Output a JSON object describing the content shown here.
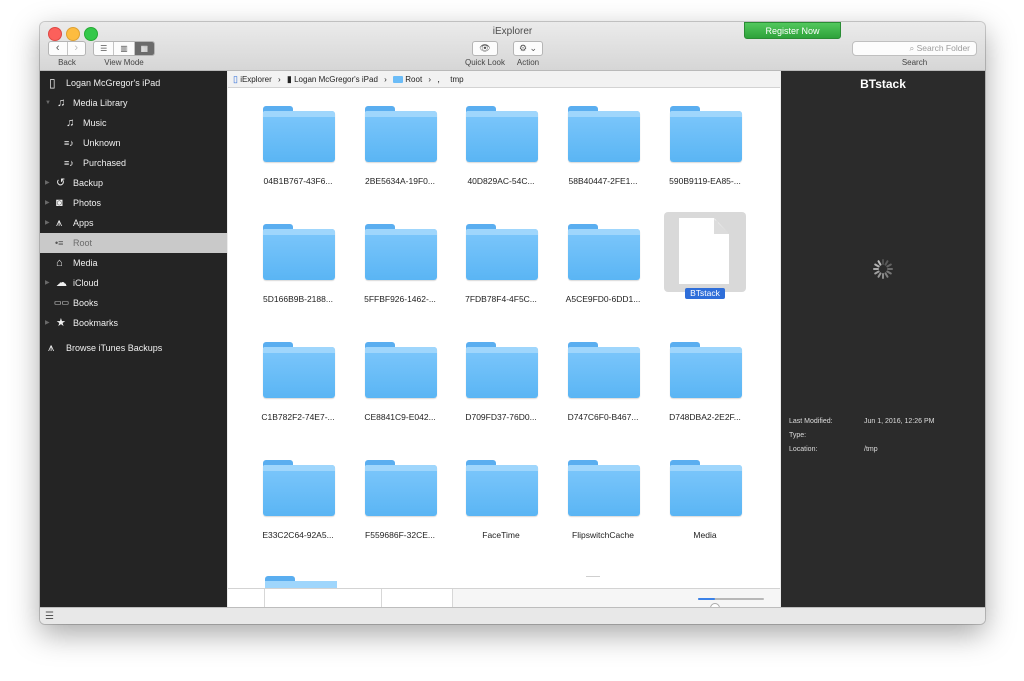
{
  "window": {
    "title": "iExplorer",
    "register_label": "Register Now"
  },
  "toolbar": {
    "back_label": "Back",
    "view_mode_label": "View Mode",
    "quick_look_label": "Quick Look",
    "action_label": "Action",
    "search_placeholder": "Search Folder",
    "search_label": "Search",
    "back_glyph": "‹",
    "forward_glyph": "›",
    "view_glyphs": [
      "☰",
      "▥",
      "▦"
    ],
    "quick_look_glyph": "👁",
    "action_glyph": "⚙ ⌄",
    "search_glyph": "⌕"
  },
  "sidebar": {
    "items": [
      {
        "label": "Logan McGregor's iPad",
        "icon": "ipad-icon",
        "glyph": "▯"
      },
      {
        "label": "Media Library",
        "icon": "music-note-icon",
        "glyph": "♫"
      },
      {
        "label": "Music",
        "icon": "music-note-icon",
        "glyph": "♫"
      },
      {
        "label": "Unknown",
        "icon": "playlist-icon",
        "glyph": "≡♪"
      },
      {
        "label": "Purchased",
        "icon": "playlist-icon",
        "glyph": "≡♪"
      },
      {
        "label": "Backup",
        "icon": "backup-icon",
        "glyph": "↺"
      },
      {
        "label": "Photos",
        "icon": "camera-icon",
        "glyph": "◙"
      },
      {
        "label": "Apps",
        "icon": "apps-icon",
        "glyph": "⩚"
      },
      {
        "label": "Root",
        "icon": "root-icon",
        "glyph": "•≡"
      },
      {
        "label": "Media",
        "icon": "home-media-icon",
        "glyph": "⌂"
      },
      {
        "label": "iCloud",
        "icon": "cloud-icon",
        "glyph": "☁"
      },
      {
        "label": "Books",
        "icon": "book-icon",
        "glyph": "▭▭"
      },
      {
        "label": "Bookmarks",
        "icon": "star-icon",
        "glyph": "★"
      },
      {
        "label": "Browse iTunes Backups",
        "icon": "apps-icon",
        "glyph": "⩚"
      }
    ],
    "selected": "Root"
  },
  "pathbar": {
    "crumbs": [
      "iExplorer",
      "Logan McGregor's iPad",
      "Root",
      "",
      "tmp"
    ],
    "separator": "›"
  },
  "files": [
    "04B1B767-43F6...",
    "2BE5634A-19F0...",
    "40D829AC-54C...",
    "58B40447-2FE1...",
    "590B9119-EA85-...",
    "5D166B9B-2188...",
    "5FFBF926-1462-...",
    "7FDB78F4-4F5C...",
    "A5CE9FD0-6DD1...",
    "BTstack",
    "C1B782F2-74E7-...",
    "CE8841C9-E042...",
    "D709FD37-76D0...",
    "D747C6F0-B467...",
    "D748DBA2-2E2F...",
    "E33C2C64-92A5...",
    "F559686F-32CE...",
    "FaceTime",
    "FlipswitchCache",
    "Media"
  ],
  "selected_file": "BTstack",
  "info_panel": {
    "title": "BTstack",
    "last_modified_label": "Last Modified:",
    "last_modified_value": "Jun 1, 2016, 12:26 PM",
    "type_label": "Type:",
    "type_value": "",
    "location_label": "Location:",
    "location_value": "/tmp"
  },
  "zoom_slider": {
    "level": 0.25
  },
  "colors": {
    "folder": "#6bbcf7",
    "selection": "#2f6ed9",
    "sidebar_bg": "#242424",
    "register_green": "#3cb54a"
  }
}
